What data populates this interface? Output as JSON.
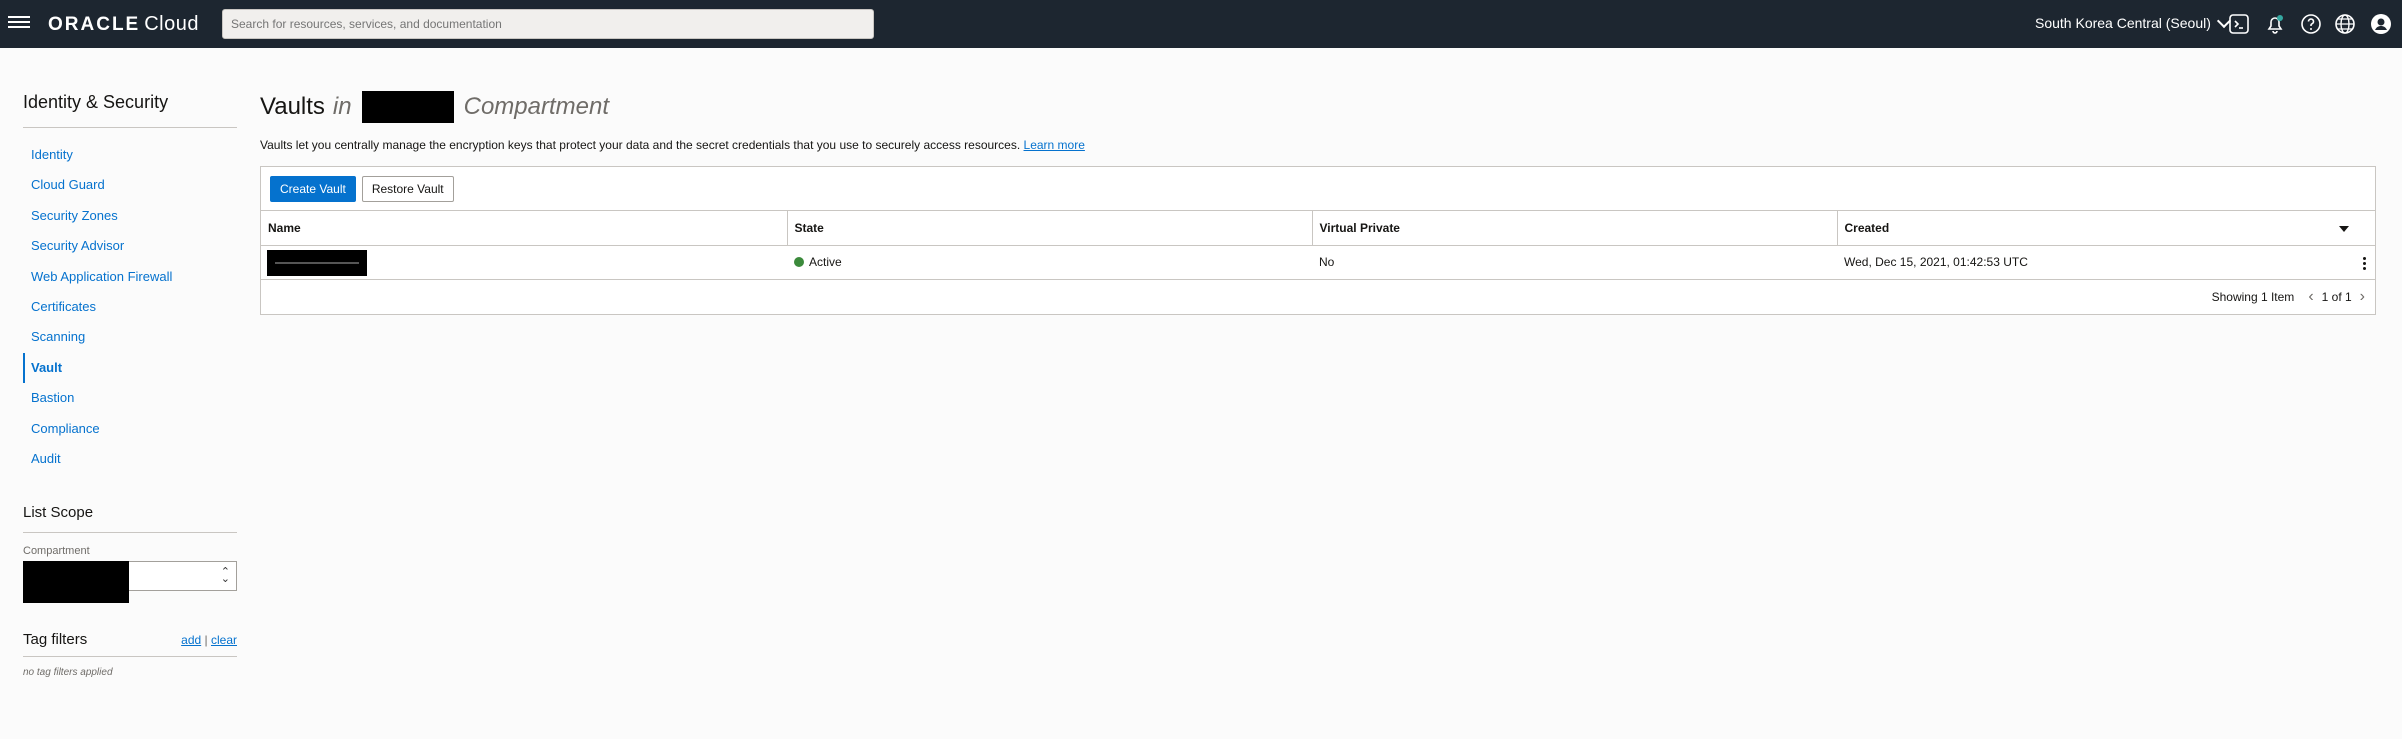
{
  "topbar": {
    "brand": "ORACLE",
    "product": "Cloud",
    "search_placeholder": "Search for resources, services, and documentation",
    "region": "South Korea Central (Seoul)",
    "icons": [
      "hamburger-menu-icon",
      "cloud-shell-icon",
      "notifications-icon",
      "help-icon",
      "language-icon",
      "profile-icon"
    ]
  },
  "sidebar": {
    "title": "Identity & Security",
    "items": [
      {
        "label": "Identity",
        "active": false
      },
      {
        "label": "Cloud Guard",
        "active": false
      },
      {
        "label": "Security Zones",
        "active": false
      },
      {
        "label": "Security Advisor",
        "active": false
      },
      {
        "label": "Web Application Firewall",
        "active": false
      },
      {
        "label": "Certificates",
        "active": false
      },
      {
        "label": "Scanning",
        "active": false
      },
      {
        "label": "Vault",
        "active": true
      },
      {
        "label": "Bastion",
        "active": false
      },
      {
        "label": "Compliance",
        "active": false
      },
      {
        "label": "Audit",
        "active": false
      }
    ],
    "list_scope": {
      "title": "List Scope",
      "compartment_label": "Compartment"
    },
    "tag_filters": {
      "title": "Tag filters",
      "add": "add",
      "separator": "|",
      "clear": "clear",
      "empty": "no tag filters applied"
    }
  },
  "main": {
    "title": "Vaults",
    "title_in": "in",
    "title_compartment": "Compartment",
    "description": "Vaults let you centrally manage the encryption keys that protect your data and the secret credentials that you use to securely access resources.",
    "learn_more": "Learn more",
    "toolbar": {
      "create": "Create Vault",
      "restore": "Restore Vault"
    },
    "table": {
      "columns": [
        "Name",
        "State",
        "Virtual Private",
        "Created"
      ],
      "rows": [
        {
          "name": "",
          "state": "Active",
          "virtual_private": "No",
          "created": "Wed, Dec 15, 2021, 01:42:53 UTC"
        }
      ]
    },
    "pager": {
      "showing": "Showing 1 Item",
      "page": "1 of 1"
    }
  },
  "colors": {
    "topbar": "#1d2630",
    "link": "#0572ce",
    "primary_button": "#0572ce",
    "status_active": "#3b8a3b"
  }
}
